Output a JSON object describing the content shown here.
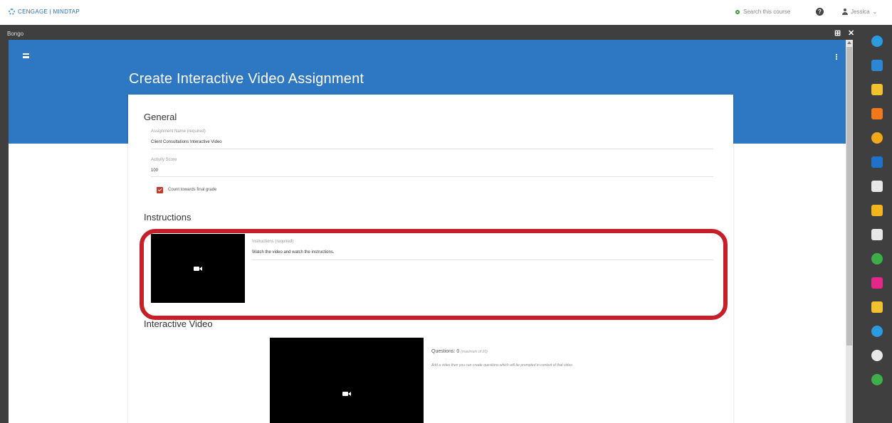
{
  "topbar": {
    "brand": "CENGAGE | MINDTAP",
    "search_placeholder": "Search this course",
    "user_name": "Jessica"
  },
  "frame": {
    "title": "Bongo"
  },
  "page": {
    "title": "Create Interactive Video Assignment"
  },
  "general": {
    "heading": "General",
    "assignment_name_label": "Assignment Name (required)",
    "assignment_name_value": "Client Consultations Interactive Video",
    "activity_score_label": "Activity Score",
    "activity_score_value": "100",
    "count_label": "Count towards final grade",
    "count_checked": true
  },
  "instructions": {
    "heading": "Instructions",
    "label": "Instructions (required)",
    "value": "Watch the video and watch the instructions."
  },
  "interactive_video": {
    "heading": "Interactive Video",
    "questions_label": "Questions: 0",
    "questions_max": "(maximum of 20)",
    "help_text": "Add a video then you can create questions which will be prompted in context of that video"
  },
  "colors": {
    "header_blue": "#2e77c2",
    "frame_dark": "#3f3f3f",
    "highlight_red": "#c51f2a",
    "checkbox_red": "#c0392b"
  },
  "rail_tools": [
    {
      "name": "bongo-icon",
      "color": "#2b9be0"
    },
    {
      "name": "briefcase-icon",
      "color": "#2b87d6"
    },
    {
      "name": "highlighter-icon",
      "color": "#f2c12e"
    },
    {
      "name": "rss-icon",
      "color": "#f07a1a"
    },
    {
      "name": "b-app-icon",
      "color": "#f1a91c"
    },
    {
      "name": "book-icon",
      "color": "#1e73c8"
    },
    {
      "name": "notes-icon",
      "color": "#e8e8e8"
    },
    {
      "name": "diagram-icon",
      "color": "#f2b51e"
    },
    {
      "name": "chat-icon",
      "color": "#e8e8e8"
    },
    {
      "name": "s-app-icon",
      "color": "#3fae49"
    },
    {
      "name": "message-icon",
      "color": "#e4288a"
    },
    {
      "name": "glossary-icon",
      "color": "#f2c12e"
    },
    {
      "name": "analytics-icon",
      "color": "#2b9be0"
    },
    {
      "name": "q-app-icon",
      "color": "#e8e8e8"
    },
    {
      "name": "o-app-icon",
      "color": "#3fae49"
    }
  ]
}
